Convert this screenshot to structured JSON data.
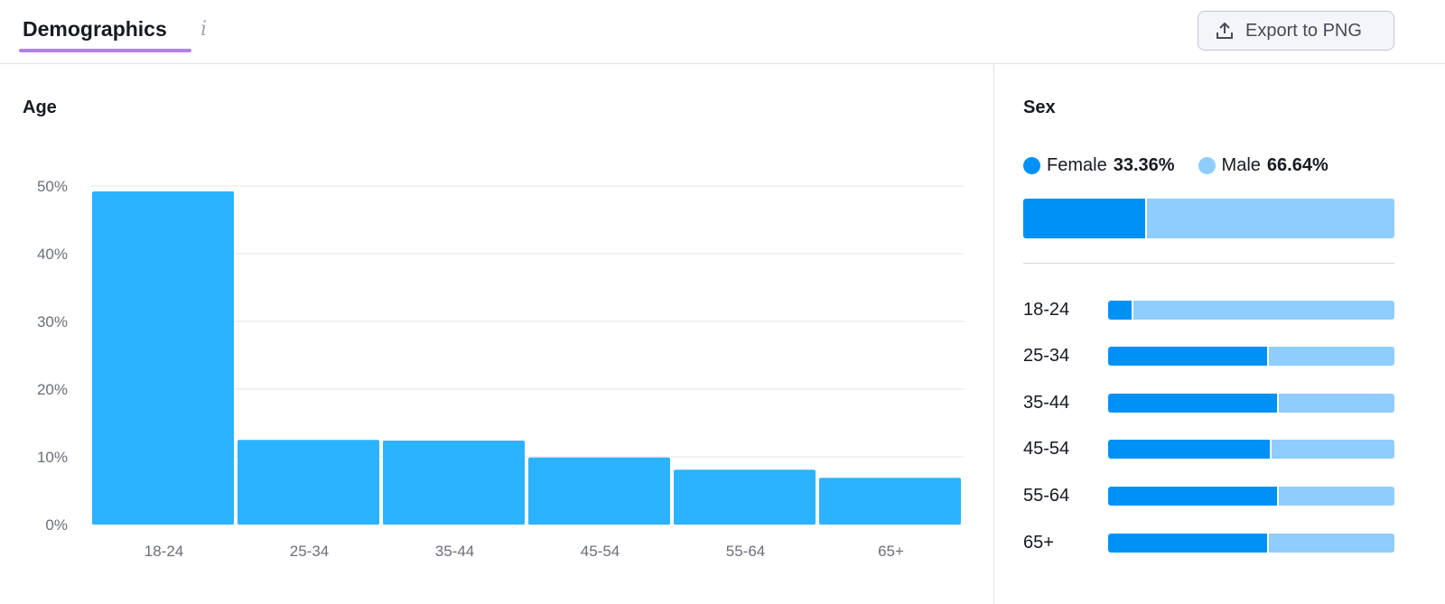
{
  "header": {
    "title": "Demographics",
    "info_icon": "info-icon",
    "export_label": "Export to PNG",
    "export_icon": "upload-icon"
  },
  "colors": {
    "bar": "#2bb3ff",
    "female": "#0091f7",
    "male": "#8fcdff",
    "accent": "#b07ff0"
  },
  "age": {
    "title": "Age"
  },
  "chart_data": {
    "type": "bar",
    "title": "Age",
    "xlabel": "",
    "ylabel": "",
    "categories": [
      "18-24",
      "25-34",
      "35-44",
      "45-54",
      "55-64",
      "65+"
    ],
    "values": [
      49.2,
      12.5,
      12.4,
      9.9,
      8.1,
      6.9
    ],
    "ylim": [
      0,
      50
    ],
    "yticks": [
      "0%",
      "10%",
      "20%",
      "30%",
      "40%",
      "50%"
    ],
    "grid": true
  },
  "sex": {
    "title": "Sex",
    "female_label": "Female",
    "female_value": "33.36%",
    "female_pct": 33.36,
    "male_label": "Male",
    "male_value": "66.64%",
    "male_pct": 66.64,
    "rows": [
      {
        "label": "18-24",
        "female_pct": 8.8
      },
      {
        "label": "25-34",
        "female_pct": 56
      },
      {
        "label": "35-44",
        "female_pct": 59.6
      },
      {
        "label": "45-54",
        "female_pct": 57
      },
      {
        "label": "55-64",
        "female_pct": 59.6
      },
      {
        "label": "65+",
        "female_pct": 56
      }
    ]
  }
}
